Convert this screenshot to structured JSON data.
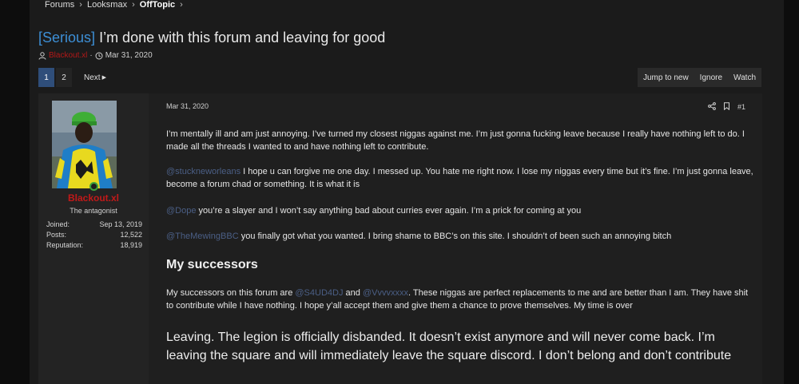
{
  "breadcrumb": {
    "items": [
      "Forums",
      "Looksmax",
      "OffTopic"
    ],
    "separator": "›"
  },
  "thread": {
    "prefix": "[Serious]",
    "title": "I’m done with this forum and leaving for good",
    "author": "Blackout.xl",
    "date": "Mar 31, 2020"
  },
  "pagination": {
    "pages": [
      "1",
      "2"
    ],
    "current": "1",
    "next_label": "Next"
  },
  "actions": {
    "jump": "Jump to new",
    "ignore": "Ignore",
    "watch": "Watch"
  },
  "user": {
    "name": "Blackout.xl",
    "title": "The antagonist",
    "online": true,
    "stats": [
      {
        "label": "Joined:",
        "value": "Sep 13, 2019"
      },
      {
        "label": "Posts:",
        "value": "12,522"
      },
      {
        "label": "Reputation:",
        "value": "18,919"
      }
    ]
  },
  "post": {
    "date": "Mar 31, 2020",
    "number": "#1",
    "p1": "I’m mentally ill and am just annoying. I’ve turned my closest niggas against me. I’m just gonna fucking leave because I really have nothing left to do. I made all the threads I wanted to and have nothing left to contribute.",
    "p2_mention": "@stuckneworleans",
    "p2": " I hope u can forgive me one day. I messed up. You hate me right now. I lose my niggas every time but it’s fine. I’m just gonna leave, become a forum chad or something. It is what it is",
    "p3_mention": "@Dope",
    "p3": " you’re a slayer and I won’t say anything bad about curries ever again. I’m a prick for coming at you",
    "p4_mention": "@TheMewingBBC",
    "p4": " you finally got what you wanted. I bring shame to BBC’s on this site. I shouldn’t of been such an annoying bitch",
    "heading": "My successors",
    "p5_a": "My successors on this forum are ",
    "p5_m1": "@S4UD4DJ",
    "p5_b": " and ",
    "p5_m2": "@Vvvvxxxx",
    "p5_c": ". These niggas are perfect replacements to me and are better than I am. They have shit to contribute while I have nothing. I hope y’all accept them and give them a chance to prove themselves. My time is over",
    "p6": "Leaving. The legion is officially disbanded. It doesn’t exist anymore and will never come back. I’m leaving the square and will immediately leave the square discord. I don’t belong and don’t contribute"
  },
  "colors": {
    "accent": "#2f4e7a",
    "prefix": "#3d8fd6",
    "username": "#c21919",
    "mention": "#4b5f86",
    "online": "#3ca23c"
  },
  "icons": [
    "user-icon",
    "clock-icon",
    "share-icon",
    "bookmark-icon",
    "chevron-right-icon"
  ]
}
